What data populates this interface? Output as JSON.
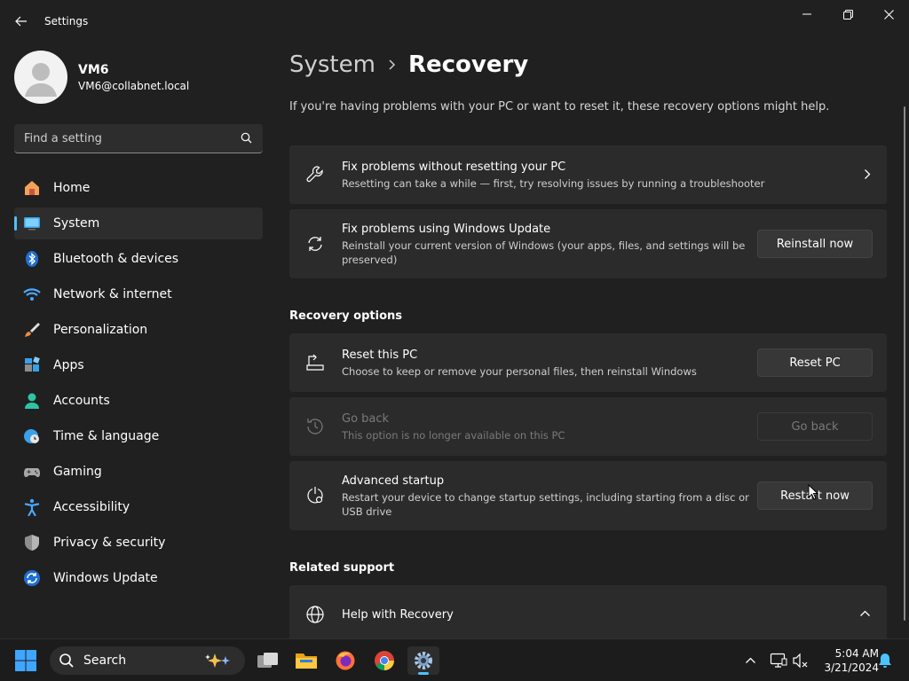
{
  "window": {
    "title": "Settings",
    "back_icon": "back-arrow-icon",
    "controls": [
      "minimize-icon",
      "restore-icon",
      "close-icon"
    ]
  },
  "profile": {
    "name": "VM6",
    "email": "VM6@collabnet.local",
    "avatar_icon": "user-avatar-icon"
  },
  "search": {
    "placeholder": "Find a setting",
    "icon": "search-icon"
  },
  "sidebar": {
    "selected": "System",
    "items": [
      {
        "label": "Home",
        "icon": "home-icon"
      },
      {
        "label": "System",
        "icon": "monitor-icon"
      },
      {
        "label": "Bluetooth & devices",
        "icon": "bluetooth-icon"
      },
      {
        "label": "Network & internet",
        "icon": "wifi-icon"
      },
      {
        "label": "Personalization",
        "icon": "brush-icon"
      },
      {
        "label": "Apps",
        "icon": "apps-icon"
      },
      {
        "label": "Accounts",
        "icon": "person-icon"
      },
      {
        "label": "Time & language",
        "icon": "globe-clock-icon"
      },
      {
        "label": "Gaming",
        "icon": "gamepad-icon"
      },
      {
        "label": "Accessibility",
        "icon": "accessibility-icon"
      },
      {
        "label": "Privacy & security",
        "icon": "shield-icon"
      },
      {
        "label": "Windows Update",
        "icon": "update-icon"
      }
    ]
  },
  "main": {
    "breadcrumb": {
      "parent": "System",
      "current": "Recovery"
    },
    "intro": "If you're having problems with your PC or want to reset it, these recovery options might help.",
    "top_cards": [
      {
        "title": "Fix problems without resetting your PC",
        "desc": "Resetting can take a while — first, try resolving issues by running a troubleshooter",
        "icon": "wrench-icon"
      },
      {
        "title": "Fix problems using Windows Update",
        "desc_line1": "Reinstall your current version of Windows (your apps, files, and settings will be",
        "desc_line2": "preserved)",
        "button": "Reinstall now",
        "icon": "sync-icon"
      }
    ],
    "recovery_options": {
      "heading": "Recovery options",
      "items": [
        {
          "title": "Reset this PC",
          "desc": "Choose to keep or remove your personal files, then reinstall Windows",
          "button": "Reset PC",
          "icon": "reset-pc-icon",
          "enabled": true
        },
        {
          "title": "Go back",
          "desc": "This option is no longer available on this PC",
          "button": "Go back",
          "icon": "history-icon",
          "enabled": false
        },
        {
          "title": "Advanced startup",
          "desc_line1": "Restart your device to change startup settings, including starting from a disc or",
          "desc_line2": "USB drive",
          "button": "Restart now",
          "icon": "advanced-startup-icon",
          "enabled": true
        }
      ]
    },
    "related_support": {
      "heading": "Related support",
      "items": [
        {
          "title": "Help with Recovery",
          "icon": "globe-icon",
          "expanded": true
        }
      ]
    }
  },
  "taskbar": {
    "search_label": "Search",
    "apps": [
      "task-view-icon",
      "file-explorer-icon",
      "firefox-icon",
      "chrome-icon",
      "settings-icon"
    ],
    "active_app": "settings-icon",
    "tray": [
      "chevron-up-icon",
      "network-icon",
      "volume-muted-icon"
    ],
    "time": "5:04 AM",
    "date": "3/21/2024",
    "notification_icon": "bell-icon"
  },
  "colors": {
    "background": "#202020",
    "card": "#2b2b2b",
    "accent": "#4cc2ff",
    "taskbar": "#1c1c1c"
  }
}
